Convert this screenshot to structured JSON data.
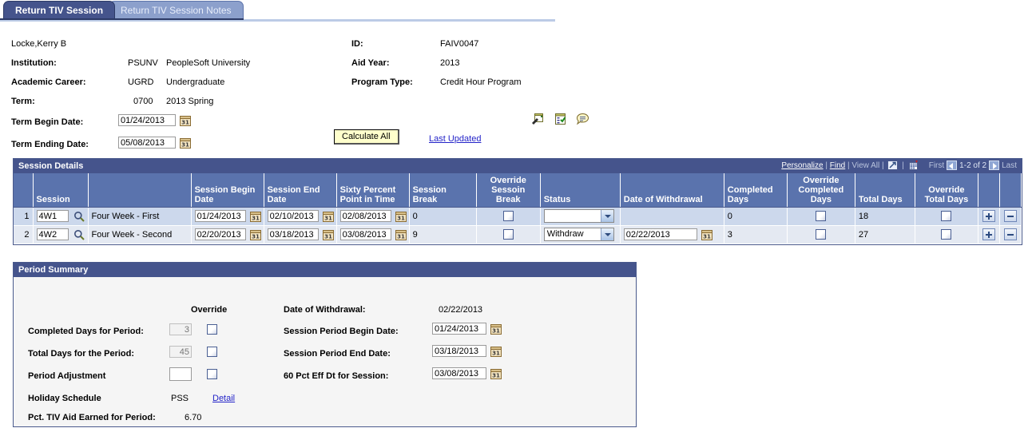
{
  "tabs": [
    {
      "label": "Return TIV Session",
      "active": true
    },
    {
      "label": "Return TIV Session Notes",
      "active": false
    }
  ],
  "header": {
    "student_name": "Locke,Kerry B",
    "institution_label": "Institution:",
    "institution_code": "PSUNV",
    "institution_name": "PeopleSoft University",
    "career_label": "Academic Career:",
    "career_code": "UGRD",
    "career_name": "Undergraduate",
    "term_label": "Term:",
    "term_code": "0700",
    "term_name": "2013 Spring",
    "term_begin_label": "Term Begin Date:",
    "term_begin_value": "01/24/2013",
    "term_end_label": "Term Ending Date:",
    "term_end_value": "05/08/2013",
    "id_label": "ID:",
    "id_value": "FAIV0047",
    "aid_year_label": "Aid Year:",
    "aid_year_value": "2013",
    "program_type_label": "Program Type:",
    "program_type_value": "Credit Hour Program",
    "calculate_all_label": "Calculate All",
    "last_updated_label": "Last Updated",
    "icons": [
      "notepad-pen-icon",
      "checklist-icon",
      "comment-bubble-icon"
    ]
  },
  "session_details": {
    "title": "Session Details",
    "nav": {
      "personalize": "Personalize",
      "sep1": "|",
      "find": "Find",
      "sep2": "|",
      "view_all": "View All",
      "sep3": "|",
      "expand_icon": "expand-icon",
      "sep4": "|",
      "grid_icon": "download-grid-icon",
      "first": "First",
      "prev_icon": "previous-page-icon",
      "counter": "1-2 of 2",
      "next_icon": "next-page-icon",
      "last": "Last"
    },
    "columns": [
      "",
      "Session",
      "",
      "Session Begin Date",
      "Session End Date",
      "Sixty Percent Point in Time",
      "Session Break",
      "Override Sessoin Break",
      "Status",
      "Date of Withdrawal",
      "Completed Days",
      "Override Completed Days",
      "Total Days",
      "Override Total Days",
      "",
      ""
    ],
    "rows": [
      {
        "num": "1",
        "session_code": "4W1",
        "session_desc": "Four Week - First",
        "begin_date": "01/24/2013",
        "end_date": "02/10/2013",
        "sixty_pct": "02/08/2013",
        "session_break": "0",
        "override_session_break": false,
        "status": "",
        "date_of_withdrawal": "",
        "has_withdrawal_field": false,
        "completed_days": "0",
        "override_completed_days": false,
        "total_days": "18",
        "override_total_days": false,
        "add_label": "+",
        "remove_label": "-"
      },
      {
        "num": "2",
        "session_code": "4W2",
        "session_desc": "Four Week - Second",
        "begin_date": "02/20/2013",
        "end_date": "03/18/2013",
        "sixty_pct": "03/08/2013",
        "session_break": "9",
        "override_session_break": false,
        "status": "Withdraw",
        "date_of_withdrawal": "02/22/2013",
        "has_withdrawal_field": true,
        "completed_days": "3",
        "override_completed_days": false,
        "total_days": "27",
        "override_total_days": false,
        "add_label": "+",
        "remove_label": "-"
      }
    ]
  },
  "period_summary": {
    "title": "Period Summary",
    "override_header": "Override",
    "completed_days_label": "Completed Days for Period:",
    "completed_days_value": "3",
    "total_days_label": "Total Days for the Period:",
    "total_days_value": "45",
    "period_adjustment_label": "Period Adjustment",
    "period_adjustment_value": "",
    "holiday_schedule_label": "Holiday Schedule",
    "holiday_schedule_value": "PSS",
    "holiday_detail_link": "Detail",
    "pct_tiv_label": "Pct. TIV Aid Earned for Period:",
    "pct_tiv_value": "6.70",
    "date_of_withdrawal_label": "Date of Withdrawal:",
    "date_of_withdrawal_value": "02/22/2013",
    "session_begin_label": "Session Period Begin Date:",
    "session_begin_value": "01/24/2013",
    "session_end_label": "Session Period End Date:",
    "session_end_value": "03/18/2013",
    "sixty_pct_label": "60 Pct Eff Dt for Session:",
    "sixty_pct_value": "03/08/2013"
  },
  "colors": {
    "tab_active": "#45548c",
    "tab_inactive": "#8ca0cc",
    "grid_header": "#5a73ad",
    "section_header": "#45548c",
    "row_alt_1": "#ccd8ec",
    "row_alt_2": "#e4e9f2",
    "link": "#2323c8",
    "button": "#ffffcc"
  }
}
